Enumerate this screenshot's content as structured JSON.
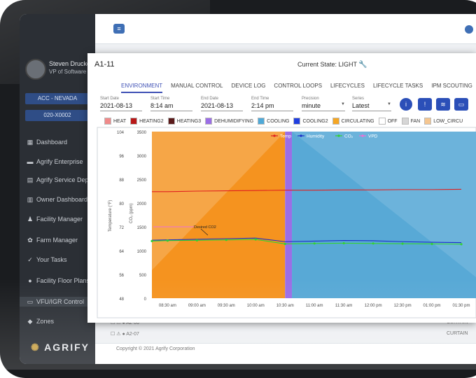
{
  "user": {
    "name": "Steven Drucker",
    "role": "VP of Software"
  },
  "account": {
    "primary": "ACC - NEVADA",
    "secondary": "020-X0002"
  },
  "sidebar": {
    "items": [
      {
        "label": "Dashboard",
        "icon": "dashboard-icon",
        "glyph": "▦"
      },
      {
        "label": "Agrify Enterprise",
        "icon": "enterprise-icon",
        "glyph": "▬"
      },
      {
        "label": "Agrify Service Dept",
        "icon": "service-icon",
        "glyph": "▤"
      },
      {
        "label": "Owner Dashboard",
        "icon": "owner-icon",
        "glyph": "▥"
      },
      {
        "label": "Facility Manager",
        "icon": "people-icon",
        "glyph": "♟"
      },
      {
        "label": "Farm Manager",
        "icon": "farm-icon",
        "glyph": "✿"
      },
      {
        "label": "Your Tasks",
        "icon": "tasks-icon",
        "glyph": "✓"
      },
      {
        "label": "Facility Floor Plans",
        "icon": "location-icon",
        "glyph": "●"
      },
      {
        "label": "VFU/IGR Control",
        "icon": "control-icon",
        "glyph": "▭"
      },
      {
        "label": "Zones",
        "icon": "zones-icon",
        "glyph": "◆"
      }
    ]
  },
  "brand": {
    "logo": "AGRIFY",
    "mark": "✺"
  },
  "footer": {
    "copyright": "Copyright © 2021 Agrify Corporation"
  },
  "background_rows": [
    {
      "id": "A2-06",
      "status": "CURTAIN"
    },
    {
      "id": "A2-07",
      "status": "CURTAIN"
    }
  ],
  "modal": {
    "title": "A1-11",
    "state_label": "Current State: LIGHT",
    "tabs": [
      "ENVIRONMENT",
      "MANUAL CONTROL",
      "DEVICE LOG",
      "CONTROL LOOPS",
      "LIFECYCLES",
      "LIFECYCLE TASKS",
      "IPM SCOUTING"
    ],
    "fields": {
      "start_date": {
        "label": "Start Date",
        "value": "2021-08-13"
      },
      "start_time": {
        "label": "Start Time",
        "value": "8:14 am"
      },
      "end_date": {
        "label": "End Date",
        "value": "2021-08-13"
      },
      "end_time": {
        "label": "End Time",
        "value": "2:14 pm"
      },
      "precision": {
        "label": "Precision",
        "value": "minute"
      },
      "series": {
        "label": "Series",
        "value": "Latest"
      }
    },
    "tools": [
      {
        "icon": "info-icon",
        "glyph": "i"
      },
      {
        "icon": "flag-icon",
        "glyph": "!"
      },
      {
        "icon": "waves-icon",
        "glyph": "≋"
      },
      {
        "icon": "ruler-icon",
        "glyph": "▭"
      }
    ],
    "state_legend": [
      {
        "label": "HEAT",
        "color": "#f08a8a"
      },
      {
        "label": "HEATING2",
        "color": "#b81818"
      },
      {
        "label": "HEATING3",
        "color": "#5a1a1a"
      },
      {
        "label": "DEHUMIDIFYING",
        "color": "#9b6ee6"
      },
      {
        "label": "COOLING",
        "color": "#4fa9d8"
      },
      {
        "label": "COOLING2",
        "color": "#1f3ee0"
      },
      {
        "label": "CIRCULATING",
        "color": "#f5a623"
      },
      {
        "label": "OFF",
        "color": "#ffffff"
      },
      {
        "label": "FAN",
        "color": "#d6d6d6"
      },
      {
        "label": "LOW_CIRCU",
        "color": "#f5c690"
      }
    ]
  },
  "chart_data": {
    "type": "line",
    "x_ticks": [
      "08:30 am",
      "09:00 am",
      "09:30 am",
      "10:00 am",
      "10:30 am",
      "11:00 am",
      "11:30 am",
      "12:00 pm",
      "12:30 pm",
      "01:00 pm",
      "01:30 pm"
    ],
    "y_left": {
      "label": "Temperature (°F)",
      "ticks": [
        48,
        56,
        64,
        72,
        80,
        88,
        96,
        104
      ],
      "range": [
        48,
        104
      ]
    },
    "y_right": {
      "label": "CO₂ (ppm)",
      "ticks": [
        0,
        500,
        1000,
        1500,
        2000,
        2500,
        3000,
        3500
      ],
      "range": [
        0,
        3500
      ]
    },
    "series_legend": [
      {
        "name": "Temp",
        "color": "#e02020"
      },
      {
        "name": "Humidity",
        "color": "#1a2ec9"
      },
      {
        "name": "CO₂",
        "color": "#33d133"
      },
      {
        "name": "VPD",
        "color": "#f06fd6"
      }
    ],
    "x": [
      "08:14",
      "08:30",
      "09:00",
      "09:30",
      "10:00",
      "10:30",
      "11:00",
      "11:30",
      "12:00",
      "12:30",
      "13:00",
      "13:30"
    ],
    "series": [
      {
        "name": "Temp",
        "unit": "°F",
        "values": [
          83.8,
          83.8,
          84.0,
          84.1,
          84.2,
          84.3,
          84.3,
          84.4,
          84.4,
          84.5,
          84.5,
          84.6
        ]
      },
      {
        "name": "Humidity",
        "unit": "°F-axis",
        "values": [
          67.5,
          67.6,
          67.8,
          68.0,
          68.2,
          67.0,
          67.2,
          67.4,
          67.3,
          67.0,
          66.8,
          66.7
        ]
      },
      {
        "name": "CO₂",
        "unit": "ppm",
        "values": [
          1200,
          1210,
          1215,
          1225,
          1235,
          1140,
          1150,
          1155,
          1150,
          1145,
          1140,
          1135
        ]
      }
    ],
    "annotation": {
      "label": "Desired CO2",
      "value": 1500
    },
    "state_bands": [
      {
        "state": "CIRCULATING",
        "start": "08:14",
        "end": "10:30",
        "color": "#f5931f"
      },
      {
        "state": "DEHUMIDIFYING",
        "start": "10:30",
        "end": "10:37",
        "color": "#9b6ee6"
      },
      {
        "state": "COOLING",
        "start": "10:37",
        "end": "13:45",
        "color": "#58a9d6"
      }
    ]
  }
}
